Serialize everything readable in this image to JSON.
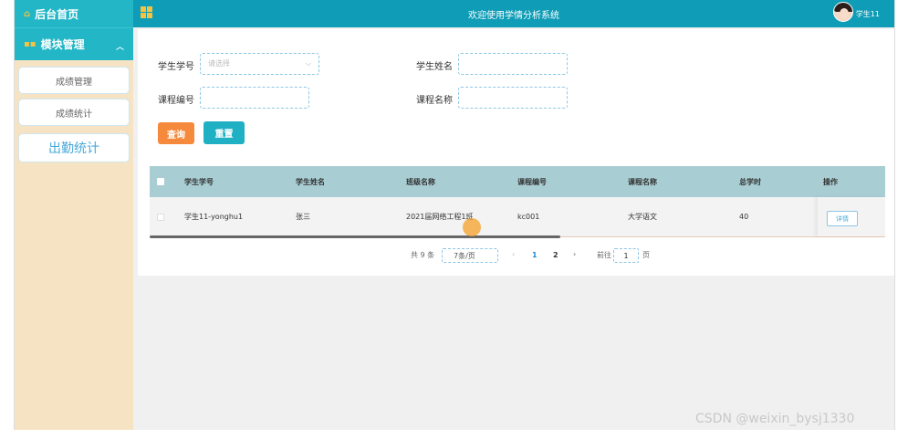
{
  "sidebar": {
    "home_label": "后台首页",
    "module_label": "模块管理",
    "items": [
      {
        "label": "成绩管理"
      },
      {
        "label": "成绩统计"
      },
      {
        "label": "出勤统计"
      }
    ]
  },
  "topbar": {
    "title": "欢迎使用学情分析系统",
    "user_name": "学生11"
  },
  "filters": {
    "student_id_label": "学生学号",
    "student_id_placeholder": "请选择",
    "student_name_label": "学生姓名",
    "student_name_value": "",
    "course_code_label": "课程编号",
    "course_code_value": "",
    "course_name_label": "课程名称",
    "course_name_value": ""
  },
  "actions": {
    "query_label": "查询",
    "reset_label": "重置"
  },
  "table": {
    "columns": [
      "学生学号",
      "学生姓名",
      "班级名称",
      "课程编号",
      "课程名称",
      "总学时",
      "操作"
    ],
    "rows": [
      {
        "student_id": "学生11-yonghu1",
        "student_name": "张三",
        "class_name": "2021届网络工程1班",
        "course_code": "kc001",
        "course_name": "大学语文",
        "total_hours": "40",
        "detail_label": "详情"
      }
    ]
  },
  "pagination": {
    "total_text": "共 9 条",
    "page_size": "7条/页",
    "prev": "‹",
    "pages": [
      "1",
      "2"
    ],
    "next": "›",
    "goto_prefix": "前往",
    "goto_value": "1",
    "goto_suffix": "页"
  },
  "watermark": "CSDN @weixin_bysj1330",
  "colors": {
    "sidebar_header": "#22b6c6",
    "topbar": "#0e9cb6",
    "sidebar_bg": "#f6e3c3",
    "query_button": "#f58a3c",
    "reset_button": "#1fb0c4",
    "table_header": "#a8cdd3",
    "active_page": "#1a8fd6"
  }
}
